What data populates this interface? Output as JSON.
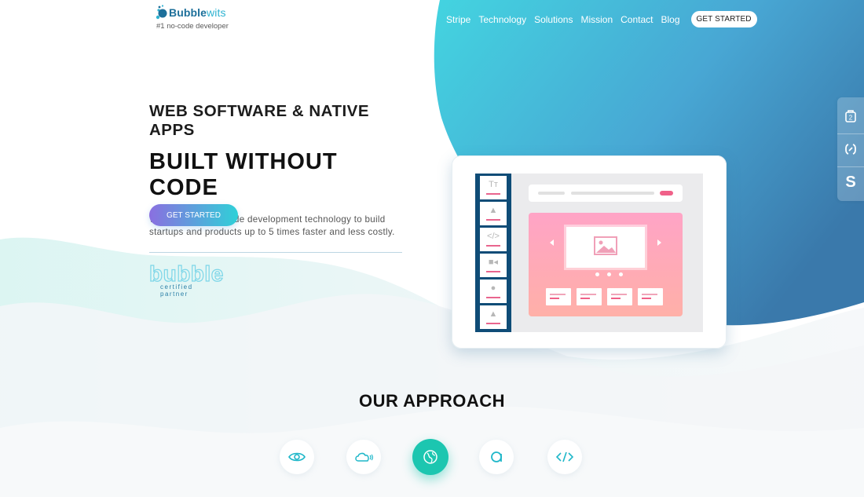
{
  "brand": {
    "name_part1": "Bubble",
    "name_part2": "wits",
    "tagline": "#1 no-code developer"
  },
  "nav": {
    "items": [
      "Stripe",
      "Technology",
      "Solutions",
      "Mission",
      "Contact",
      "Blog"
    ],
    "cta": "GET STARTED"
  },
  "hero": {
    "kicker": "WEB SOFTWARE & NATIVE APPS",
    "headline": "BUILT WITHOUT CODE",
    "lede": "We use latest no-code development technology to build startups and products up to 5 times faster and less costly.",
    "cta": "GET STARTED"
  },
  "partner": {
    "word": "bubble",
    "sub": "certified partner"
  },
  "illustration": {
    "tools": [
      "text-tool-icon",
      "image-tool-icon",
      "code-tool-icon",
      "video-tool-icon",
      "location-tool-icon",
      "notification-tool-icon"
    ],
    "tool_glyphs": [
      "Tт",
      "▲",
      "</>",
      "■◂",
      "●",
      "▲"
    ]
  },
  "side_widget": {
    "items": [
      "badge-icon",
      "code-brackets-icon",
      "stripe-s-icon"
    ],
    "stripe_letter": "S"
  },
  "approach": {
    "title": "OUR APPROACH",
    "icons": [
      "eye-icon",
      "cloud-icon",
      "globe-icon",
      "circle-a-icon",
      "code-icon"
    ],
    "active_index": 2
  },
  "colors": {
    "accent_blue": "#3fc8de",
    "deep_blue": "#3a86b8",
    "teal": "#1cc6b0",
    "pink": "#f06189",
    "purple": "#8a6fe0"
  }
}
